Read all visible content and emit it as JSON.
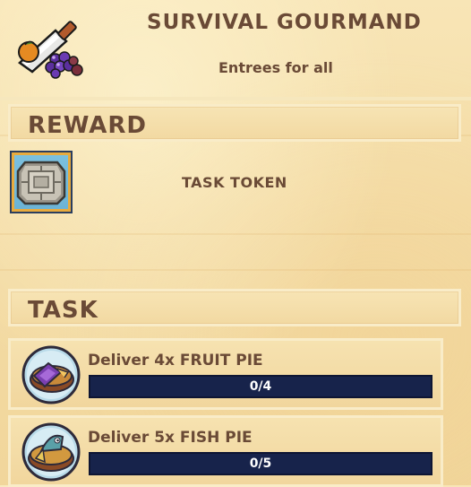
{
  "quest": {
    "title": "SURVIVAL GOURMAND",
    "subtitle": "Entrees for all",
    "icon": "cleaver-fruit-icon"
  },
  "reward": {
    "header": "REWARD",
    "item_name": "TASK TOKEN",
    "item_icon": "task-token-icon"
  },
  "task": {
    "header": "TASK",
    "items": [
      {
        "label": "Deliver 4x FRUIT PIE",
        "progress_text": "0/4",
        "progress": 0,
        "icon": "fruit-pie-icon"
      },
      {
        "label": "Deliver 5x FISH PIE",
        "progress_text": "0/5",
        "progress": 0,
        "icon": "fish-pie-icon"
      }
    ]
  },
  "colors": {
    "parchment": "#f4dca6",
    "text": "#6a4a36",
    "progress_bar": "#17234b",
    "reward_tile_border": "#e8ab3e",
    "reward_tile_bg": "#6cb4d6"
  }
}
